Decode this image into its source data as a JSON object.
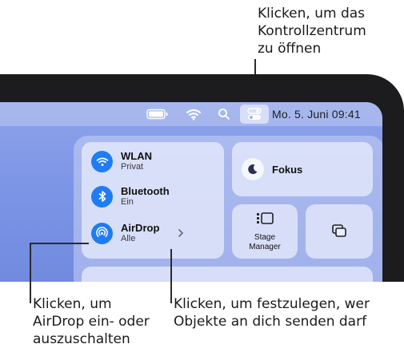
{
  "callouts": {
    "control_center": [
      "Klicken, um das",
      "Kontrollzentrum",
      "zu öffnen"
    ],
    "airdrop_toggle": [
      "Klicken, um",
      "AirDrop ein- oder",
      "auszuschalten"
    ],
    "airdrop_options": [
      "Klicken, um festzulegen, wer",
      "Objekte an dich senden darf"
    ]
  },
  "menubar": {
    "date_time": "Mo. 5. Juni  09:41",
    "icons": [
      "battery-icon",
      "wifi-icon",
      "spotlight-search-icon",
      "control-center-icon"
    ]
  },
  "control_center": {
    "network": [
      {
        "title": "WLAN",
        "subtitle": "Privat",
        "icon": "wifi-icon"
      },
      {
        "title": "Bluetooth",
        "subtitle": "Ein",
        "icon": "bluetooth-icon"
      },
      {
        "title": "AirDrop",
        "subtitle": "Alle",
        "icon": "airdrop-icon"
      }
    ],
    "focus_label": "Fokus",
    "stage_manager_label": [
      "Stage",
      "Manager"
    ]
  },
  "colors": {
    "accent_blue": "#1f7cf3",
    "device_frame": "#1c1c1e",
    "desktop": "#7e96e6"
  }
}
